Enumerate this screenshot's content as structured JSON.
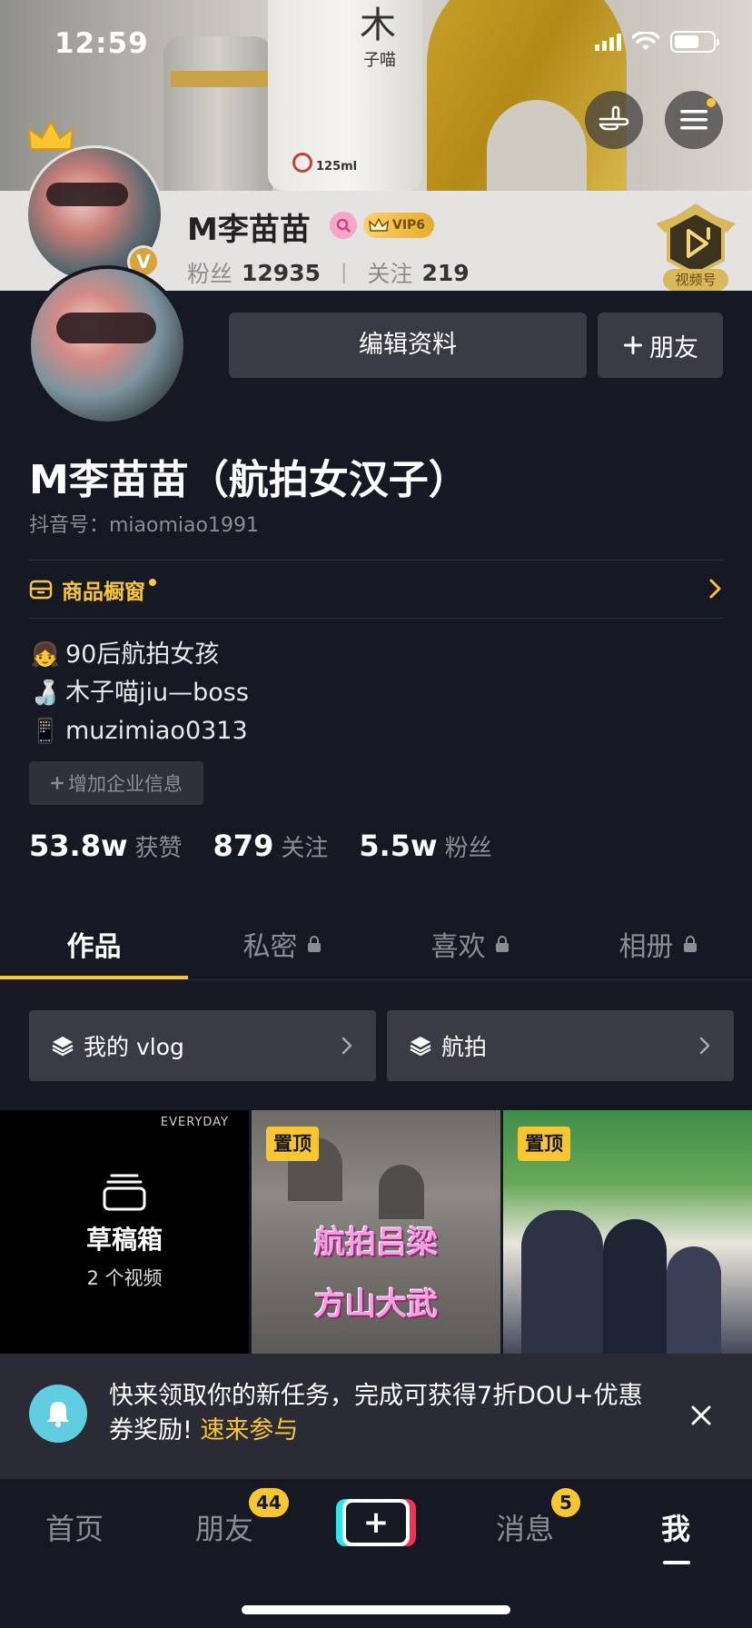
{
  "status_bar": {
    "time": "12:59"
  },
  "cover": {
    "bottle_brand_top": "木",
    "bottle_brand_bottom": "子喵",
    "bottle_volume": "125ml"
  },
  "sticky_header": {
    "name": "M李苗苗",
    "vip_label": "VIP6",
    "fans_label": "粉丝",
    "fans_count": "12935",
    "following_label": "关注",
    "following_count": "219",
    "video_channel_label": "视频号"
  },
  "profile": {
    "verified_badge": "V",
    "edit_button": "编辑资料",
    "add_friend_button": "朋友",
    "nickname": "M李苗苗（航拍女汉子）",
    "douyin_id": "抖音号：miaomiao1991",
    "shop_window_label": "商品橱窗",
    "bio": [
      {
        "emoji": "👧",
        "text": "90后航拍女孩"
      },
      {
        "emoji": "🍶",
        "text": "木子喵jiu—boss"
      },
      {
        "emoji": "📱",
        "text": "muzimiao0313"
      }
    ],
    "add_enterprise_info": "增加企业信息",
    "stats": [
      {
        "value": "53.8w",
        "label": "获赞"
      },
      {
        "value": "879",
        "label": "关注"
      },
      {
        "value": "5.5w",
        "label": "粉丝"
      }
    ]
  },
  "tabs": [
    {
      "label": "作品",
      "active": true,
      "locked": false
    },
    {
      "label": "私密",
      "active": false,
      "locked": true
    },
    {
      "label": "喜欢",
      "active": false,
      "locked": true
    },
    {
      "label": "相册",
      "active": false,
      "locked": true
    }
  ],
  "collections": [
    {
      "label": "我的 vlog"
    },
    {
      "label": "航拍"
    }
  ],
  "grid": {
    "drafts": {
      "title": "草稿箱",
      "count": "2 个视频",
      "corner_text": "EVERYDAY"
    },
    "videos": [
      {
        "pin_label": "置顶",
        "overlay_line1": "航拍吕梁",
        "overlay_line2": "方山大武"
      },
      {
        "pin_label": "置顶"
      }
    ]
  },
  "notice": {
    "text": "快来领取你的新任务，完成可获得7折DOU+优惠券奖励! ",
    "link": "速来参与"
  },
  "bottom_nav": {
    "home": "首页",
    "friends": "朋友",
    "friends_badge": "44",
    "add": "+",
    "messages": "消息",
    "messages_badge": "5",
    "me": "我"
  },
  "colors": {
    "background": "#161823",
    "accent_yellow": "#f8c72f",
    "button_gray": "#3a3b44",
    "muted_text": "#8b8c94"
  }
}
